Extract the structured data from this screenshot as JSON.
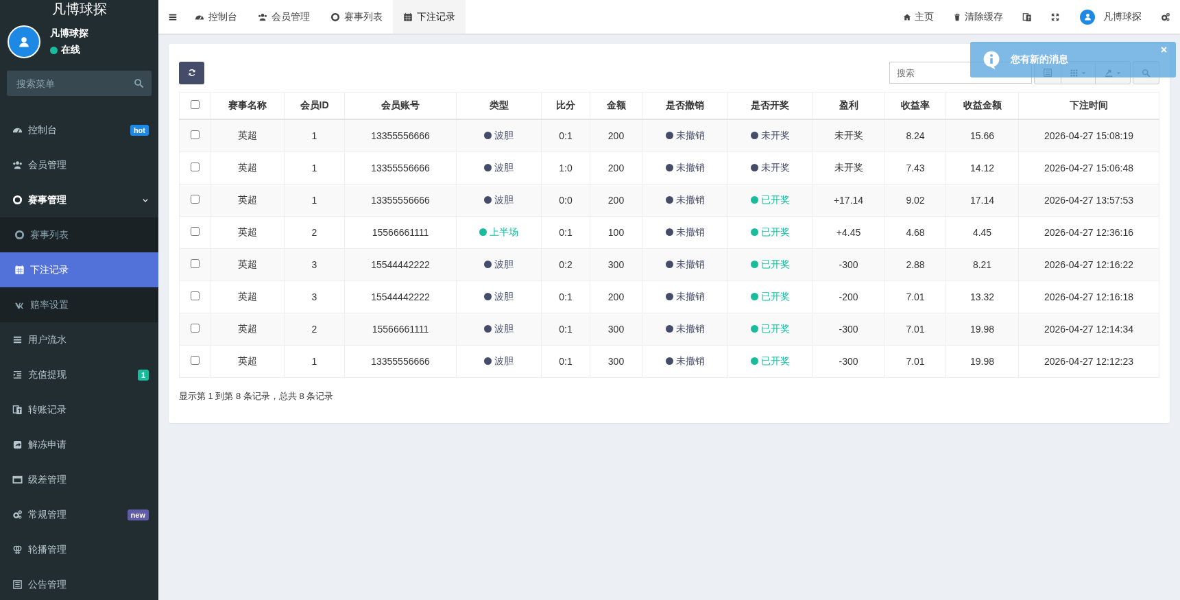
{
  "sidebar": {
    "logo": "凡博球探",
    "user": {
      "name": "凡博球探",
      "status": "在线",
      "online": true
    },
    "search": {
      "placeholder": "搜索菜单"
    },
    "items": [
      {
        "label": "控制台",
        "selected": false,
        "badge": {
          "text": "hot",
          "color": "#1e88e5"
        }
      },
      {
        "label": "会员管理",
        "selected": false
      },
      {
        "label": "赛事管理",
        "selected": false,
        "expanded": true,
        "children": [
          {
            "label": "赛事列表",
            "selected": false
          },
          {
            "label": "下注记录",
            "selected": true
          },
          {
            "label": "赔率设置",
            "selected": false
          }
        ]
      },
      {
        "label": "用户流水",
        "selected": false
      },
      {
        "label": "充值提现",
        "selected": false,
        "badge": {
          "text": "1",
          "color": "#18bc9c"
        }
      },
      {
        "label": "转账记录",
        "selected": false
      },
      {
        "label": "解冻申请",
        "selected": false
      },
      {
        "label": "级差管理",
        "selected": false
      },
      {
        "label": "常规管理",
        "selected": false,
        "badge": {
          "text": "new",
          "color": "#605ca8"
        }
      },
      {
        "label": "轮播管理",
        "selected": false
      },
      {
        "label": "公告管理",
        "selected": false
      }
    ]
  },
  "topbar": {
    "tabs": [
      {
        "label": "控制台",
        "selected": false
      },
      {
        "label": "会员管理",
        "selected": false
      },
      {
        "label": "赛事列表",
        "selected": false
      },
      {
        "label": "下注记录",
        "selected": true
      }
    ],
    "links": [
      {
        "label": "主页"
      },
      {
        "label": "清除缓存"
      }
    ],
    "user": {
      "name": "凡博球探"
    }
  },
  "toolbar": {
    "search": {
      "placeholder": "搜索"
    }
  },
  "table": {
    "all_checked": false,
    "columns": [
      "赛事名称",
      "会员ID",
      "会员账号",
      "类型",
      "比分",
      "金额",
      "是否撤销",
      "是否开奖",
      "盈利",
      "收益率",
      "收益金额",
      "下注时间"
    ],
    "rows": [
      {
        "checked": false,
        "match": "英超",
        "member_id": "1",
        "account": "13355556666",
        "type": {
          "text": "波胆",
          "color": "#444c69"
        },
        "score": "0:1",
        "amount": "200",
        "cancelled": {
          "text": "未撤销",
          "color": "#444c69"
        },
        "drawn": {
          "text": "未开奖",
          "color": "#444c69"
        },
        "profit": "未开奖",
        "rate": "8.24",
        "return": "15.66",
        "time": "2026-04-27 15:08:19"
      },
      {
        "checked": false,
        "match": "英超",
        "member_id": "1",
        "account": "13355556666",
        "type": {
          "text": "波胆",
          "color": "#444c69"
        },
        "score": "1:0",
        "amount": "200",
        "cancelled": {
          "text": "未撤销",
          "color": "#444c69"
        },
        "drawn": {
          "text": "未开奖",
          "color": "#444c69"
        },
        "profit": "未开奖",
        "rate": "7.43",
        "return": "14.12",
        "time": "2026-04-27 15:06:48"
      },
      {
        "checked": false,
        "match": "英超",
        "member_id": "1",
        "account": "13355556666",
        "type": {
          "text": "波胆",
          "color": "#444c69"
        },
        "score": "0:0",
        "amount": "200",
        "cancelled": {
          "text": "未撤销",
          "color": "#444c69"
        },
        "drawn": {
          "text": "已开奖",
          "color": "#18bc9c"
        },
        "profit": "+17.14",
        "rate": "9.02",
        "return": "17.14",
        "time": "2026-04-27 13:57:53"
      },
      {
        "checked": false,
        "match": "英超",
        "member_id": "2",
        "account": "15566661111",
        "type": {
          "text": "上半场",
          "color": "#18bc9c"
        },
        "score": "0:1",
        "amount": "100",
        "cancelled": {
          "text": "未撤销",
          "color": "#444c69"
        },
        "drawn": {
          "text": "已开奖",
          "color": "#18bc9c"
        },
        "profit": "+4.45",
        "rate": "4.68",
        "return": "4.45",
        "time": "2026-04-27 12:36:16"
      },
      {
        "checked": false,
        "match": "英超",
        "member_id": "3",
        "account": "15544442222",
        "type": {
          "text": "波胆",
          "color": "#444c69"
        },
        "score": "0:2",
        "amount": "300",
        "cancelled": {
          "text": "未撤销",
          "color": "#444c69"
        },
        "drawn": {
          "text": "已开奖",
          "color": "#18bc9c"
        },
        "profit": "-300",
        "rate": "2.88",
        "return": "8.21",
        "time": "2026-04-27 12:16:22"
      },
      {
        "checked": false,
        "match": "英超",
        "member_id": "3",
        "account": "15544442222",
        "type": {
          "text": "波胆",
          "color": "#444c69"
        },
        "score": "0:1",
        "amount": "200",
        "cancelled": {
          "text": "未撤销",
          "color": "#444c69"
        },
        "drawn": {
          "text": "已开奖",
          "color": "#18bc9c"
        },
        "profit": "-200",
        "rate": "7.01",
        "return": "13.32",
        "time": "2026-04-27 12:16:18"
      },
      {
        "checked": false,
        "match": "英超",
        "member_id": "2",
        "account": "15566661111",
        "type": {
          "text": "波胆",
          "color": "#444c69"
        },
        "score": "0:1",
        "amount": "300",
        "cancelled": {
          "text": "未撤销",
          "color": "#444c69"
        },
        "drawn": {
          "text": "已开奖",
          "color": "#18bc9c"
        },
        "profit": "-300",
        "rate": "7.01",
        "return": "19.98",
        "time": "2026-04-27 12:14:34"
      },
      {
        "checked": false,
        "match": "英超",
        "member_id": "1",
        "account": "13355556666",
        "type": {
          "text": "波胆",
          "color": "#444c69"
        },
        "score": "0:1",
        "amount": "300",
        "cancelled": {
          "text": "未撤销",
          "color": "#444c69"
        },
        "drawn": {
          "text": "已开奖",
          "color": "#18bc9c"
        },
        "profit": "-300",
        "rate": "7.01",
        "return": "19.98",
        "time": "2026-04-27 12:12:23"
      }
    ],
    "summary": "显示第 1 到第 8 条记录，总共 8 条记录"
  },
  "notification": {
    "message": "您有新的消息"
  }
}
